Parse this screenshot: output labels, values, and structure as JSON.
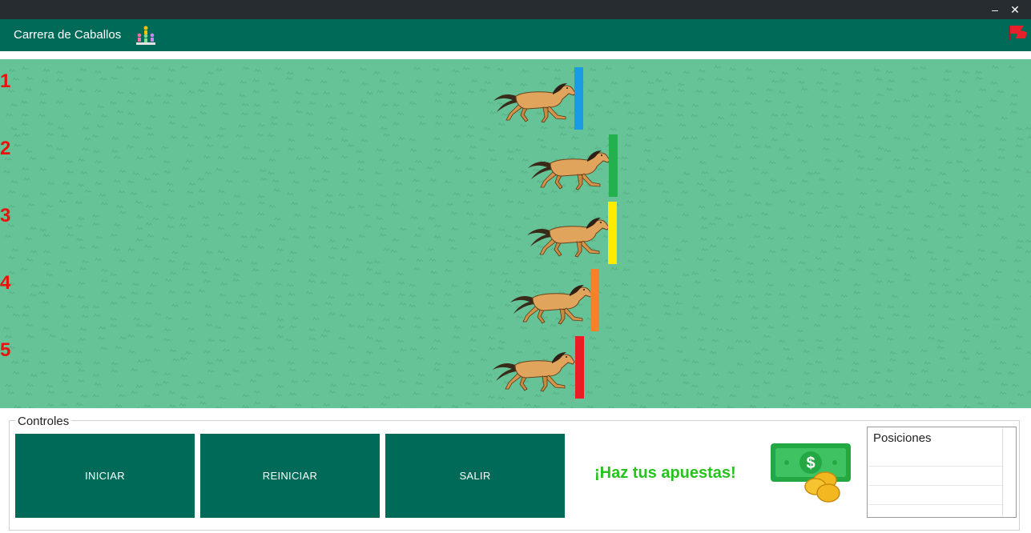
{
  "window": {
    "minimize_glyph": "‒",
    "close_glyph": "✕"
  },
  "app": {
    "title": "Carrera de Caballos",
    "icon": "people-podium-icon",
    "flag_icon": "red-flag-icon"
  },
  "race": {
    "lanes": [
      {
        "number": "1",
        "marker_color": "#1a9be6",
        "icon": "running-horse-icon"
      },
      {
        "number": "2",
        "marker_color": "#22b14c",
        "icon": "running-horse-icon"
      },
      {
        "number": "3",
        "marker_color": "#ffec00",
        "icon": "running-horse-icon"
      },
      {
        "number": "4",
        "marker_color": "#f6802b",
        "icon": "running-horse-icon"
      },
      {
        "number": "5",
        "marker_color": "#ec1c24",
        "icon": "running-horse-icon"
      }
    ]
  },
  "controls": {
    "legend": "Controles",
    "start_label": "INICIAR",
    "restart_label": "REINICIAR",
    "exit_label": "SALIR",
    "bet_text": "¡Haz tus apuestas!",
    "money_icon": "money-coins-icon"
  },
  "positions": {
    "header": "Posiciones"
  },
  "colors": {
    "appbar": "#006a58",
    "track": "#66c397",
    "button": "#006a58",
    "lane_number": "#e8140c",
    "bet_text": "#27c21d"
  }
}
